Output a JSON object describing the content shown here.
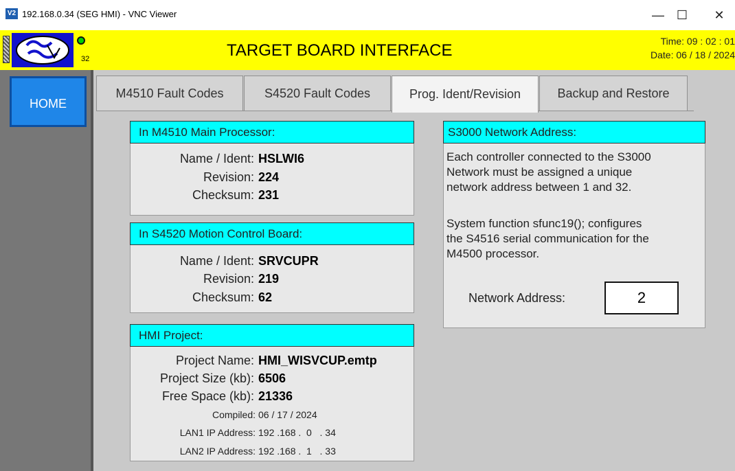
{
  "window": {
    "icon": "V2",
    "title": "192.168.0.34 (SEG HMI) - VNC Viewer",
    "minimize": "—",
    "maximize": "☐",
    "close": "✕"
  },
  "header": {
    "title": "TARGET BOARD INTERFACE",
    "led_count": "32",
    "time": "Time: 09 : 02 : 01",
    "date": "Date: 06 / 18 / 2024",
    "logo_icon": "seg-logo",
    "led_color": "#00d000",
    "bar_color": "#ffff00"
  },
  "nav": {
    "home": "HOME"
  },
  "tabs": [
    {
      "label": "M4510 Fault Codes",
      "active": false
    },
    {
      "label": "S4520 Fault Codes",
      "active": false
    },
    {
      "label": "Prog. Ident/Revision",
      "active": true
    },
    {
      "label": "Backup and Restore",
      "active": false
    }
  ],
  "m4510": {
    "header": "In M4510 Main Processor:",
    "name_label": "Name / Ident:",
    "name": "HSLWI6",
    "revision_label": "Revision:",
    "revision": "224",
    "checksum_label": "Checksum:",
    "checksum": "231"
  },
  "s4520": {
    "header": "In S4520 Motion Control Board:",
    "name_label": "Name / Ident:",
    "name": "SRVCUPR",
    "revision_label": "Revision:",
    "revision": "219",
    "checksum_label": "Checksum:",
    "checksum": "62"
  },
  "hmi": {
    "header": "HMI Project:",
    "project_name_label": "Project Name:",
    "project_name": "HMI_WISVCUP.emtp",
    "project_size_label": "Project Size (kb):",
    "project_size": "6506",
    "free_space_label": "Free Space (kb):",
    "free_space": "21336",
    "compiled_label": "Compiled:",
    "compiled": "06 / 17 / 2024",
    "lan1_label": "LAN1 IP Address:",
    "lan1": "192 .168 .  0   . 34",
    "lan2_label": "LAN2 IP Address:",
    "lan2": "192 .168 .  1   . 33"
  },
  "network": {
    "header": "S3000 Network Address:",
    "para1_l1": "Each controller connected to the S3000",
    "para1_l2": "Network must be assigned a unique",
    "para1_l3": "network address between 1 and 32.",
    "para2_l1": "System function sfunc19(); configures",
    "para2_l2": "the S4516 serial communication for the",
    "para2_l3": "M4500 processor.",
    "address_label": "Network Address:",
    "address": "2"
  },
  "colors": {
    "accent_cyan": "#00ffff",
    "home_blue": "#1f86e8"
  }
}
